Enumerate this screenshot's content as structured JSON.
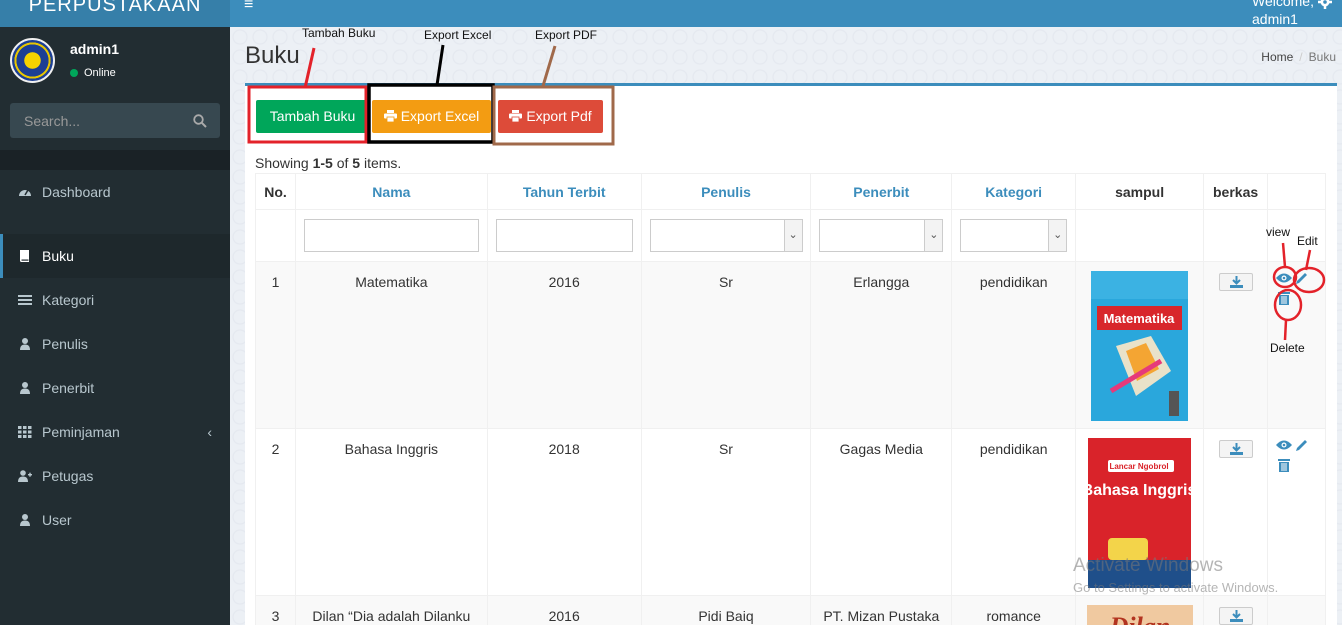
{
  "app": {
    "title": "PERPUSTAKAAN"
  },
  "header": {
    "welcome": "Welcome,",
    "user": "admin1"
  },
  "sidebar": {
    "user": {
      "name": "admin1",
      "status": "Online"
    },
    "search_placeholder": "Search...",
    "items": [
      {
        "label": "Dashboard",
        "icon": "dashboard-icon"
      },
      {
        "label": "Buku",
        "icon": "book-icon"
      },
      {
        "label": "Kategori",
        "icon": "list-icon"
      },
      {
        "label": "Penulis",
        "icon": "user-icon"
      },
      {
        "label": "Penerbit",
        "icon": "user-icon"
      },
      {
        "label": "Peminjaman",
        "icon": "grid-icon"
      },
      {
        "label": "Petugas",
        "icon": "user-plus-icon"
      },
      {
        "label": "User",
        "icon": "user-icon"
      }
    ]
  },
  "page": {
    "title": "Buku",
    "breadcrumb": [
      "Home",
      "Buku"
    ],
    "buttons": {
      "add": "Tambah Buku",
      "excel": "Export Excel",
      "pdf": "Export Pdf"
    },
    "summary": {
      "prefix": "Showing ",
      "range": "1-5",
      "of": " of ",
      "total": "5",
      "suffix": " items."
    }
  },
  "table": {
    "columns": [
      "No.",
      "Nama",
      "Tahun Terbit",
      "Penulis",
      "Penerbit",
      "Kategori",
      "sampul",
      "berkas"
    ],
    "rows": [
      {
        "no": "1",
        "nama": "Matematika",
        "tahun": "2016",
        "penulis": "Sr",
        "penerbit": "Erlangga",
        "kategori": "pendidikan",
        "cover_title": "Matematika"
      },
      {
        "no": "2",
        "nama": "Bahasa Inggris",
        "tahun": "2018",
        "penulis": "Sr",
        "penerbit": "Gagas Media",
        "kategori": "pendidikan",
        "cover_title": "Bahasa Inggris"
      },
      {
        "no": "3",
        "nama": "Dilan “Dia adalah Dilanku",
        "tahun": "2016",
        "penulis": "Pidi Baiq",
        "penerbit": "PT. Mizan Pustaka",
        "kategori": "romance",
        "cover_title": "Dilan"
      }
    ]
  },
  "annotations": {
    "tambah": "Tambah Buku",
    "excel": "Export Excel",
    "pdf": "Export PDF",
    "view": "view",
    "edit": "Edit",
    "delete": "Delete"
  },
  "watermark": {
    "line1": "Activate Windows",
    "line2": "Go to Settings to activate Windows."
  },
  "colors": {
    "header": "#3c8dbc",
    "sidebar": "#222d32",
    "green": "#00a65a",
    "orange": "#f39c12",
    "red": "#dd4b39"
  }
}
